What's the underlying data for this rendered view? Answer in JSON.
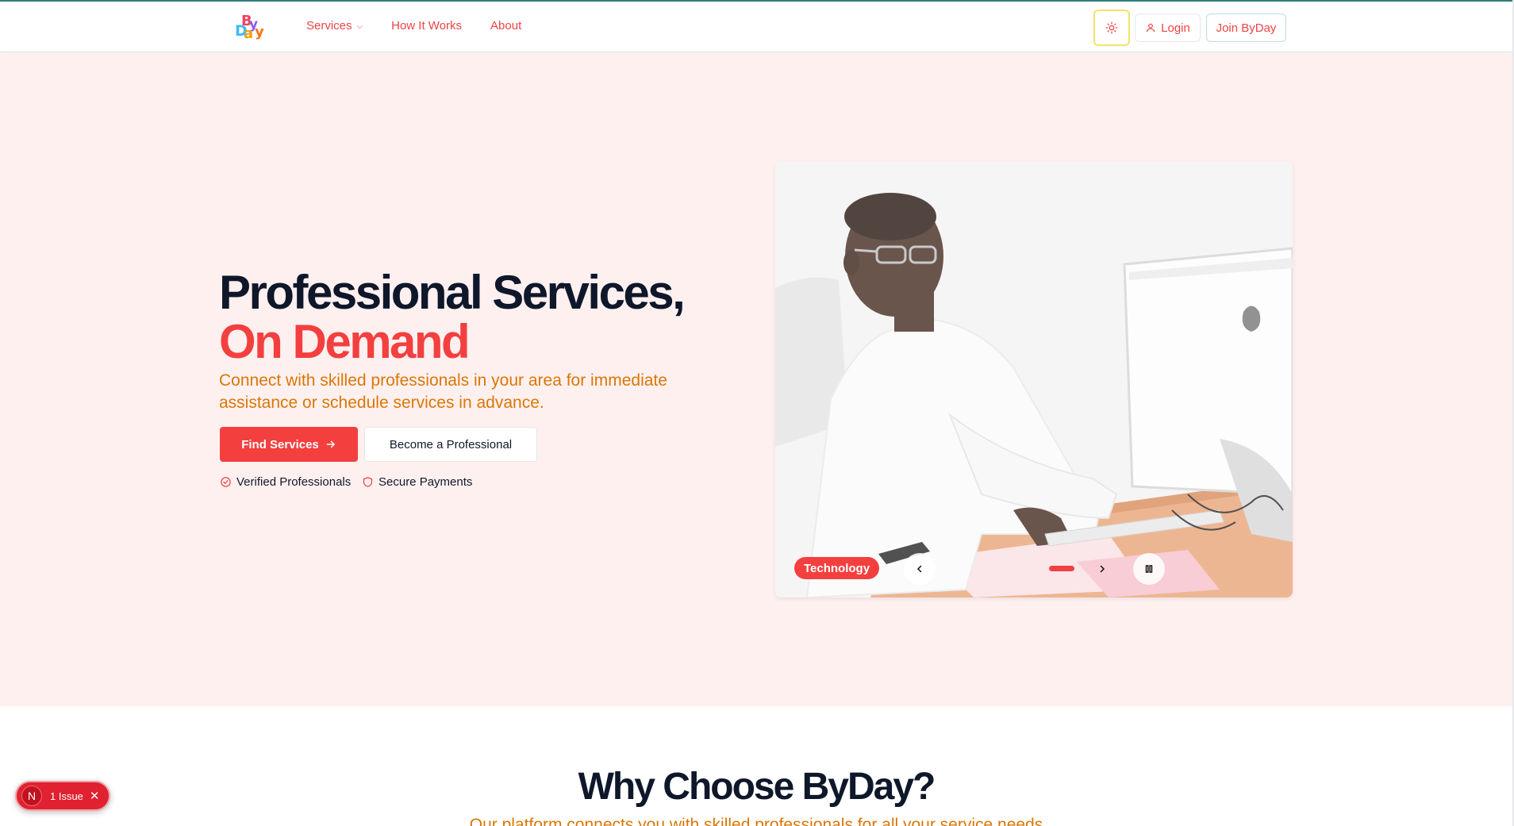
{
  "header": {
    "logo_text": "ByDay",
    "nav": [
      {
        "label": "Services",
        "has_dropdown": true
      },
      {
        "label": "How It Works"
      },
      {
        "label": "About"
      }
    ],
    "login_label": "Login",
    "join_label": "Join ByDay"
  },
  "hero": {
    "title_line1": "Professional Services,",
    "title_line2": "On Demand",
    "subtitle": "Connect with skilled professionals in your area for immediate assistance or schedule services in advance.",
    "primary_button": "Find Services",
    "secondary_button": "Become a Professional",
    "features": [
      "Verified Professionals",
      "Secure Payments"
    ]
  },
  "carousel": {
    "category_chip": "Technology",
    "active_slide": 1,
    "playing": true
  },
  "why": {
    "title": "Why Choose ByDay?",
    "subtitle": "Our platform connects you with skilled professionals for all your service needs"
  },
  "issue_badge": {
    "icon_letter": "N",
    "label": "1 Issue"
  },
  "colors": {
    "accent": "#f43f3f",
    "hero_bg": "#fff0f0",
    "subtitle": "#d97706"
  }
}
